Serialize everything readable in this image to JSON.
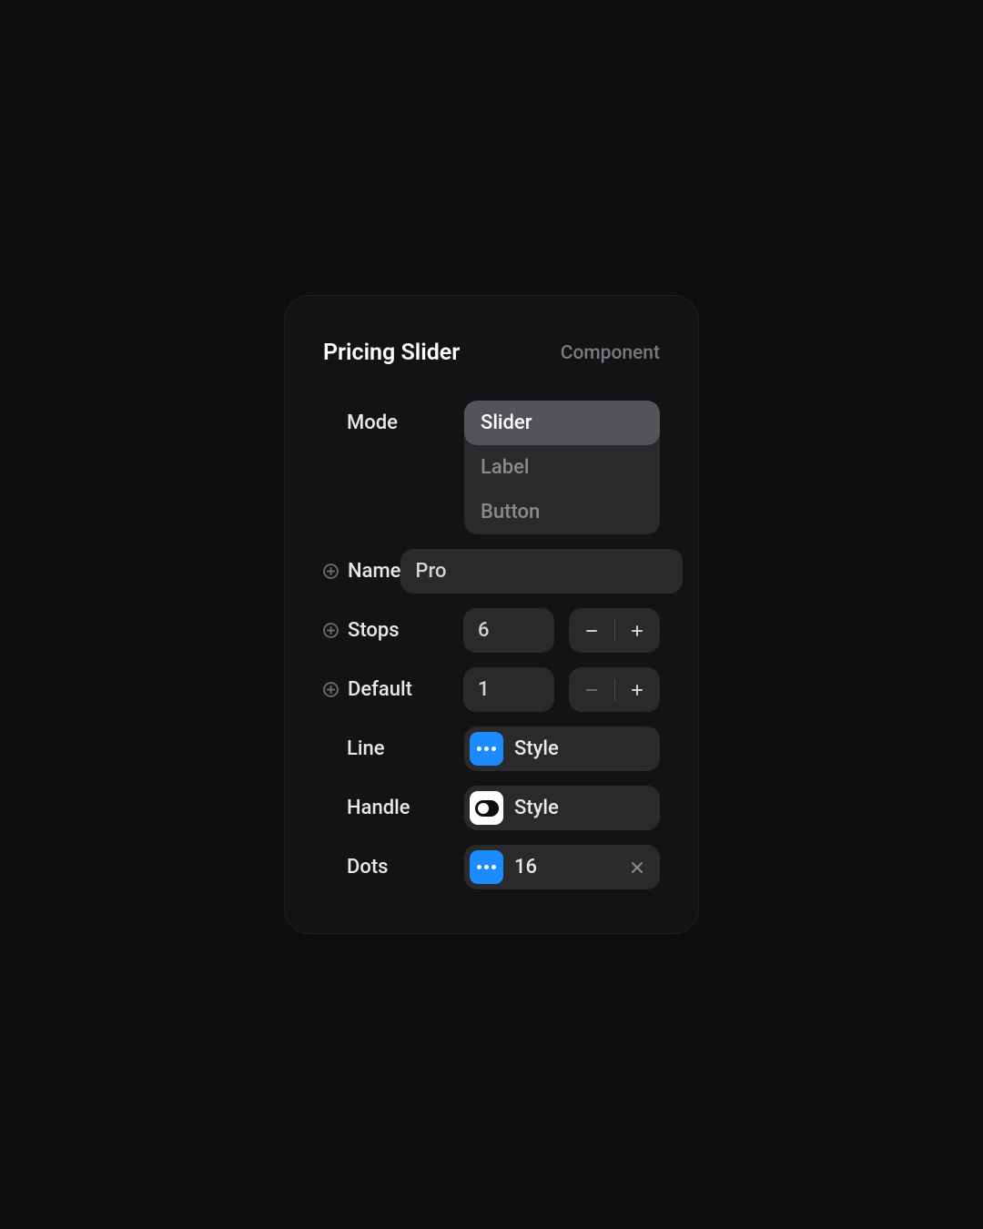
{
  "header": {
    "title": "Pricing Slider",
    "subtitle": "Component"
  },
  "fields": {
    "mode": {
      "label": "Mode",
      "options": [
        "Slider",
        "Label",
        "Button"
      ],
      "selected": "Slider"
    },
    "name": {
      "label": "Name",
      "value": "Pro"
    },
    "stops": {
      "label": "Stops",
      "value": "6"
    },
    "default": {
      "label": "Default",
      "value": "1"
    },
    "line": {
      "label": "Line",
      "value": "Style"
    },
    "handle": {
      "label": "Handle",
      "value": "Style"
    },
    "dots": {
      "label": "Dots",
      "value": "16"
    }
  }
}
